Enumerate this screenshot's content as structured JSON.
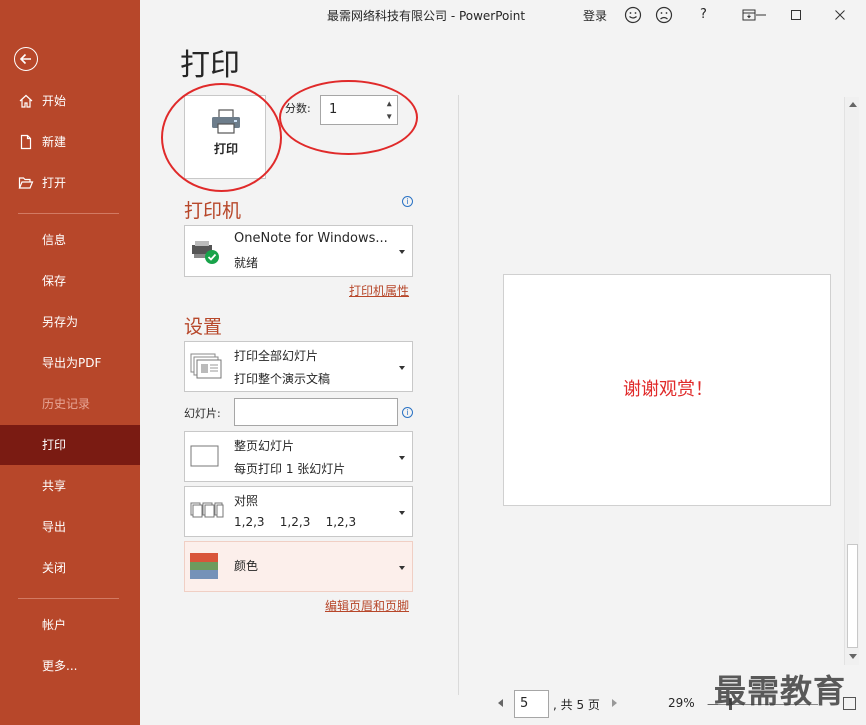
{
  "titlebar": {
    "title": "最需网络科技有限公司  -  PowerPoint",
    "login": "登录",
    "help": "?"
  },
  "nav": {
    "items": [
      {
        "label": "开始"
      },
      {
        "label": "新建"
      },
      {
        "label": "打开"
      },
      {
        "label": "信息"
      },
      {
        "label": "保存"
      },
      {
        "label": "另存为"
      },
      {
        "label": "导出为PDF"
      },
      {
        "label": "历史记录"
      },
      {
        "label": "打印"
      },
      {
        "label": "共享"
      },
      {
        "label": "导出"
      },
      {
        "label": "关闭"
      },
      {
        "label": "帐户"
      },
      {
        "label": "更多..."
      }
    ]
  },
  "print": {
    "page_title": "打印",
    "print_button": "打印",
    "copies_label": "分数:",
    "copies_value": "1",
    "up_arrow": "▲",
    "down_arrow": "▼"
  },
  "printer": {
    "heading": "打印机",
    "info": "i",
    "name": "OneNote for Windows...",
    "status": "就绪",
    "properties_link": "打印机属性"
  },
  "settings": {
    "heading": "设置",
    "range_line1": "打印全部幻灯片",
    "range_line2": "打印整个演示文稿",
    "slides_label": "幻灯片:",
    "slides_value": "",
    "info": "i",
    "layout_line1": "整页幻灯片",
    "layout_line2": "每页打印 1 张幻灯片",
    "collate_line1": "对照",
    "collate_line2": "1,2,3    1,2,3    1,2,3",
    "color_label": "颜色",
    "header_footer_link": "编辑页眉和页脚"
  },
  "preview": {
    "slide_text": "谢谢观赏！",
    "page_value": "5",
    "page_total": ", 共 5 页",
    "zoom": "29%",
    "zoom_minus": "—"
  },
  "watermark": "最需教育",
  "colors": {
    "accent": "#b7472a",
    "nav_active": "#7a1b12",
    "annotation": "#e02a2a"
  }
}
